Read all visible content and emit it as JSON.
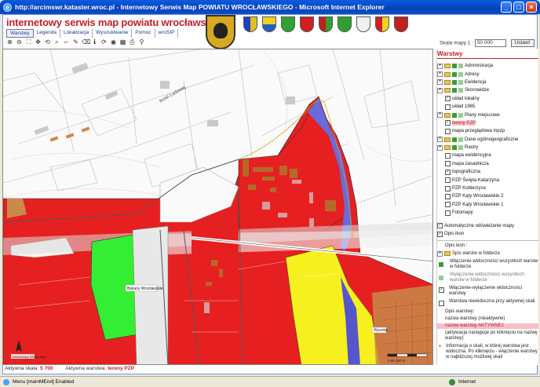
{
  "window": {
    "title": "http://arcimswr.kataster.wroc.pl - Internetowy Serwis Map POWIATU WROCŁAWSKIEGO - Microsoft Internet Explorer",
    "buttons": [
      "_",
      "□",
      "×"
    ]
  },
  "header": {
    "title": "internetowy serwis map powiatu wrocławskiego",
    "menu": [
      "Warstwy",
      "Legenda",
      "Lokalizacja",
      "Wyszukiwanie",
      "Pomoc",
      "wroSIP"
    ],
    "scale_label": "Skala mapy 1 :",
    "scale_value": "50 000",
    "scale_button": "Ustaw!",
    "tool_icons": [
      "zoom-in-icon",
      "zoom-out-icon",
      "full-extent-icon",
      "pan-icon",
      "zoom-previous-icon",
      "identify-icon",
      "measure-icon",
      "select-icon",
      "clear-icon",
      "info-icon",
      "refresh-icon",
      "globe-icon",
      "overview-icon",
      "print-icon",
      "link-icon"
    ]
  },
  "map": {
    "labels": [
      "Bielany Wrocławskie",
      "Wysoka",
      "Armii Ludowej"
    ],
    "scalebar_label": "0   50  100 m",
    "logo_label": "Internetowy Serwis Map"
  },
  "panel": {
    "title": "Warstwy",
    "layers": [
      {
        "label": "Administracja",
        "type": "group"
      },
      {
        "label": "Adresy",
        "type": "group"
      },
      {
        "label": "Ewidencja",
        "type": "group"
      },
      {
        "label": "Skorowidze",
        "type": "group"
      },
      {
        "label": "układ lokalny",
        "type": "check",
        "checked": true
      },
      {
        "label": "układ 1965",
        "type": "check",
        "checked": false
      },
      {
        "label": "Plany miejscowe",
        "type": "group"
      },
      {
        "label": "tereny PZP",
        "type": "check",
        "checked": true,
        "highlight": true
      },
      {
        "label": "mapa przeglądowa mpzp",
        "type": "check",
        "checked": false
      },
      {
        "label": "Dane ogólnogeograficzne",
        "type": "group"
      },
      {
        "label": "Rastry",
        "type": "group"
      },
      {
        "label": "mapa ewidencyjna",
        "type": "check",
        "checked": false
      },
      {
        "label": "mapa zasadnicza",
        "type": "check",
        "checked": false
      },
      {
        "label": "topograficzna",
        "type": "check",
        "checked": true
      },
      {
        "label": "PZP Święta Katarzyna",
        "type": "check",
        "checked": false
      },
      {
        "label": "PZP Kobierzyce",
        "type": "check",
        "checked": false
      },
      {
        "label": "PZP Kąty Wrocławskie 2",
        "type": "check",
        "checked": false
      },
      {
        "label": "PZP Kąty Wrocławskie 1",
        "type": "check",
        "checked": false
      },
      {
        "label": "Fotomapy",
        "type": "check",
        "checked": false
      }
    ],
    "auto_refresh": "Automatyczne odświeżanie mapy",
    "icon_desc": "Opis ikon",
    "icons_heading": "Opis ikon :",
    "icon_descriptions": [
      "Spis warstw w folderze",
      "Włączenie widoczności wszystkich warstw w folderze",
      "Wyłączenie widoczności wszystkich warstw w folderze",
      "Włączenie-wyłączenie widoczności warstwy",
      "Warstwa niewidoczna przy aktywnej skali"
    ],
    "layer_desc_heading": "Opis warstwy:",
    "inactive_layer": "nazwa warstwy (nieaktywne)",
    "active_layer": "nazwa warstwy AKTYWNEJ",
    "activation_note": "(aktywacja następuje po kliknięciu na nazwę warstwy)",
    "scale_info": "Informacja o skali, w której warstwa jest widoczna. Po kliknięciu - włączenie warstwy w najbliższej możliwej skali"
  },
  "status": {
    "active_scale_label": "Aktywna skala:",
    "active_scale": "5 700",
    "active_layer_label": "Aktywna warstwa:",
    "active_layer": "tereny PZP",
    "statusbar_text": "Menu [mainMEnd] Enabled",
    "zone": "Internet"
  },
  "colors": {
    "title_red": "#c0202a",
    "zone_red": "#e62020",
    "zone_yellow": "#f5f01e",
    "zone_green": "#33ee33",
    "zone_brown": "#c88a4a"
  }
}
